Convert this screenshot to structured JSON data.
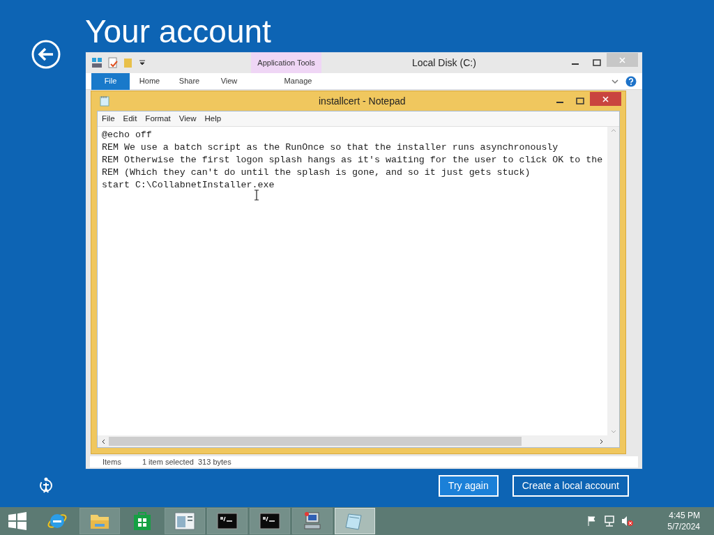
{
  "page": {
    "title": "Your account"
  },
  "explorer": {
    "title": "Local Disk (C:)",
    "context_tab_group": "Application Tools",
    "ribbon_tabs": [
      {
        "label": "File",
        "selected": true
      },
      {
        "label": "Home",
        "selected": false
      },
      {
        "label": "Share",
        "selected": false
      },
      {
        "label": "View",
        "selected": false
      },
      {
        "label": "Manage",
        "selected": false
      }
    ],
    "status_bar": [
      "Items",
      "1 item selected  313 bytes"
    ]
  },
  "notepad": {
    "title": "installcert - Notepad",
    "menu": [
      "File",
      "Edit",
      "Format",
      "View",
      "Help"
    ],
    "lines": [
      "@echo off",
      "REM We use a batch script as the RunOnce so that the installer runs asynchronously",
      "REM Otherwise the first logon splash hangs as it's waiting for the user to click OK to the",
      "REM (Which they can't do until the splash is gone, and so it just gets stuck)",
      "start C:\\CollabnetInstaller.exe"
    ]
  },
  "buttons": [
    "Try again",
    "Create a local account"
  ],
  "taskbar": {
    "items": [
      {
        "kind": "ie",
        "selected": false
      },
      {
        "kind": "explorer",
        "selected": false
      },
      {
        "kind": "store",
        "selected": false
      },
      {
        "kind": "window",
        "selected": false
      },
      {
        "kind": "console",
        "selected": false
      },
      {
        "kind": "console",
        "selected": false
      },
      {
        "kind": "network",
        "selected": false
      },
      {
        "kind": "notepad",
        "selected": true
      }
    ],
    "time": "4:45 PM",
    "date": "5/7/2024"
  }
}
